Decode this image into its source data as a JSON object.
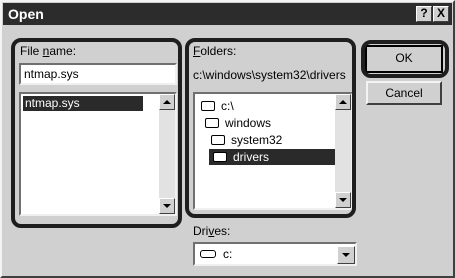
{
  "window": {
    "title": "Open",
    "help_button": "?",
    "close_button": "X"
  },
  "file_name": {
    "label_pre": "File ",
    "label_underlined": "n",
    "label_post": "ame:",
    "value": "ntmap.sys",
    "list_items": [
      "ntmap.sys"
    ]
  },
  "folders": {
    "label_underlined": "F",
    "label_post": "olders:",
    "current_path": "c:\\windows\\system32\\drivers",
    "tree": [
      {
        "name": "c:\\",
        "icon": "open-folder-icon"
      },
      {
        "name": "windows",
        "icon": "open-folder-icon"
      },
      {
        "name": "system32",
        "icon": "open-folder-icon"
      },
      {
        "name": "drivers",
        "icon": "open-folder-icon",
        "selected": true
      }
    ]
  },
  "drives": {
    "label_pre": "Dri",
    "label_underlined": "v",
    "label_post": "es:",
    "value": "c:",
    "icon": "drive-icon"
  },
  "buttons": {
    "ok": "OK",
    "cancel": "Cancel"
  }
}
